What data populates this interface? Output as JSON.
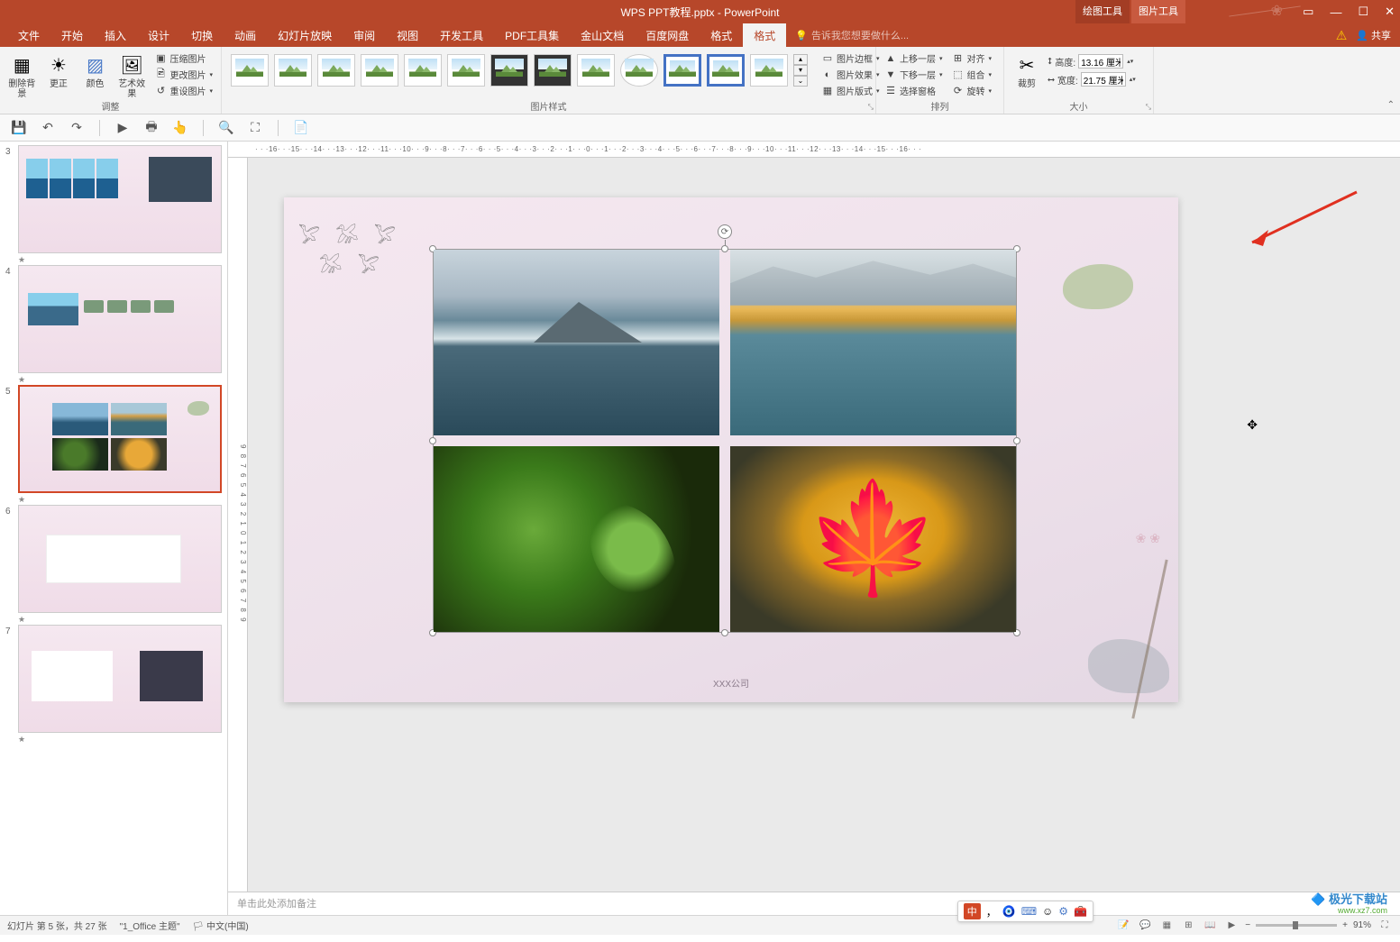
{
  "title": "WPS PPT教程.pptx - PowerPoint",
  "context_tabs": {
    "drawing": "绘图工具",
    "picture": "图片工具"
  },
  "menu": {
    "file": "文件",
    "home": "开始",
    "insert": "插入",
    "design": "设计",
    "transition": "切换",
    "animation": "动画",
    "slideshow": "幻灯片放映",
    "review": "审阅",
    "view": "视图",
    "developer": "开发工具",
    "pdf": "PDF工具集",
    "kdocs": "金山文档",
    "baidu": "百度网盘",
    "format1": "格式",
    "format2": "格式"
  },
  "tell_me": "告诉我您想要做什么...",
  "share": "共享",
  "ribbon": {
    "adjust": {
      "label": "调整",
      "remove_bg": "删除背景",
      "correct": "更正",
      "color": "颜色",
      "artistic": "艺术效果",
      "compress": "压缩图片",
      "change": "更改图片",
      "reset": "重设图片"
    },
    "styles": {
      "label": "图片样式",
      "border": "图片边框",
      "effects": "图片效果",
      "layout": "图片版式"
    },
    "arrange": {
      "label": "排列",
      "forward": "上移一层",
      "backward": "下移一层",
      "selection_pane": "选择窗格",
      "align": "对齐",
      "group": "组合",
      "rotate": "旋转"
    },
    "size": {
      "label": "大小",
      "crop": "裁剪",
      "height_lbl": "高度:",
      "height_val": "13.16 厘米",
      "width_lbl": "宽度:",
      "width_val": "21.75 厘米"
    }
  },
  "ruler_h": "· · ·16· · ·15· · ·14· · ·13· · ·12· · ·11· · ·10· · ·9· · ·8· · ·7· · ·6· · ·5· · ·4· · ·3· · ·2· · ·1· · ·0· · ·1· · ·2· · ·3· · ·4· · ·5· · ·6· · ·7· · ·8· · ·9· · ·10· · ·11· · ·12· · ·13· · ·14· · ·15· · ·16· · ·",
  "ruler_v": "9  8  7  6  5  4  3  2  1  0  1  2  3  4  5  6  7  8  9",
  "thumbs": {
    "n3": "3",
    "n4": "4",
    "n5": "5",
    "n6": "6",
    "n7": "7"
  },
  "slide": {
    "company": "XXX公司"
  },
  "notes_placeholder": "单击此处添加备注",
  "status": {
    "slide_info": "幻灯片 第 5 张，共 27 张",
    "theme": "\"1_Office 主题\"",
    "lang_mode": "中文(中国)",
    "zoom": "91%"
  },
  "ime": {
    "badge": "中",
    "comma": "，",
    "smile": "☺"
  },
  "watermark": {
    "line1": "极光下载站",
    "line2": "www.xz7.com"
  }
}
